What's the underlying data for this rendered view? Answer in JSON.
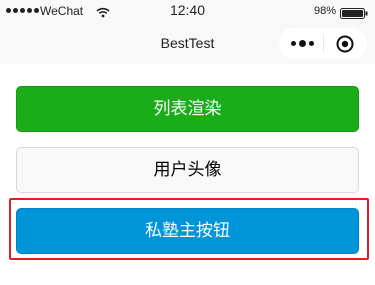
{
  "status_bar": {
    "carrier": "WeChat",
    "time": "12:40",
    "battery": "98%"
  },
  "nav": {
    "title": "BestTest"
  },
  "buttons": {
    "list_render": "列表渲染",
    "user_avatar": "用户头像",
    "primary": "私塾主按钮"
  },
  "colors": {
    "green": "#1aad19",
    "blue": "#0095d9",
    "highlight": "#e02020"
  },
  "icons": [
    "signal-icon",
    "wifi-icon",
    "battery-icon",
    "more-icon",
    "close-icon"
  ]
}
